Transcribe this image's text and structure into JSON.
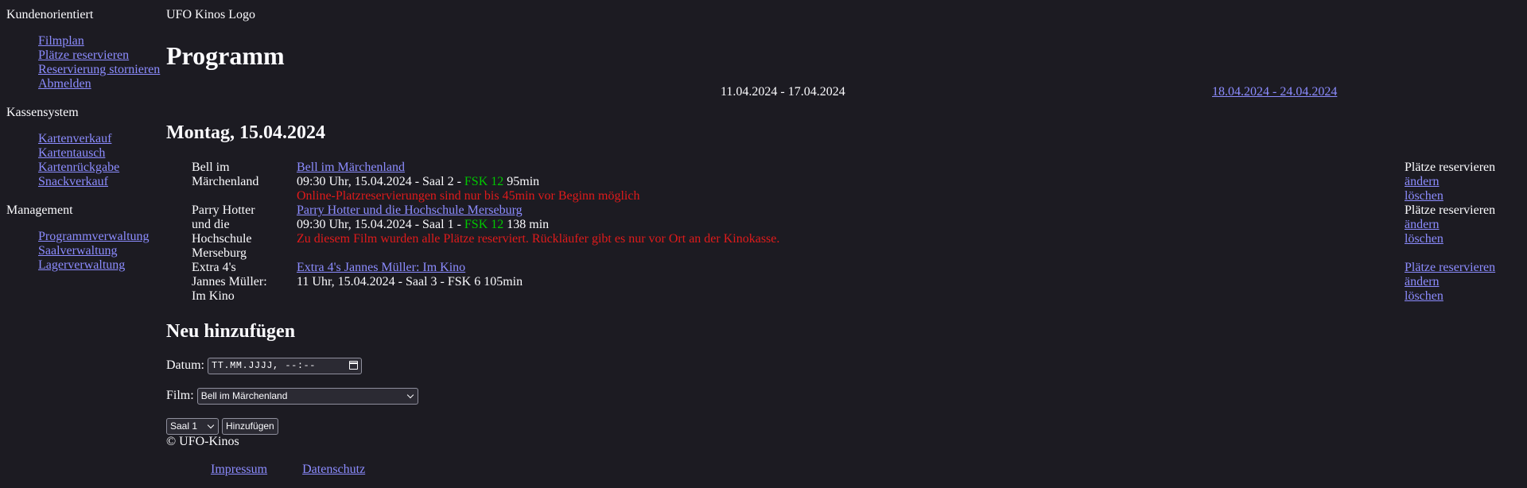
{
  "sidebar": {
    "sections": [
      {
        "heading": "Kundenorientiert",
        "items": [
          "Filmplan",
          "Plätze reservieren",
          "Reservierung stornieren",
          "Abmelden"
        ]
      },
      {
        "heading": "Kassensystem",
        "items": [
          "Kartenverkauf",
          "Kartentausch",
          "Kartenrückgabe",
          "Snackverkauf"
        ]
      },
      {
        "heading": "Management",
        "items": [
          "Programmverwaltung",
          "Saalverwaltung",
          "Lagerverwaltung"
        ]
      }
    ]
  },
  "header": {
    "logo_text": "UFO Kinos Logo",
    "title": "Programm"
  },
  "week": {
    "current": "11.04.2024 - 17.04.2024",
    "next": "18.04.2024 - 24.04.2024"
  },
  "day_title": "Montag, 15.04.2024",
  "shows": [
    {
      "short_title": "Bell im Märchenland",
      "title": "Bell im Märchenland",
      "time_prefix": "09:30 Uhr, 15.04.2024 - Saal 2 - ",
      "fsk": "FSK 12",
      "duration": " 95min",
      "warning": "Online-Platzreservierungen sind nur bis 45min vor Beginn möglich",
      "reserve_label": "Plätze reservieren",
      "edit_label": "ändern",
      "delete_label": "löschen"
    },
    {
      "short_title": "Parry Hotter und die Hochschule Merseburg",
      "title": "Parry Hotter und die Hochschule Merseburg",
      "time_prefix": "09:30 Uhr, 15.04.2024 - Saal 1 - ",
      "fsk": "FSK 12",
      "duration": " 138 min",
      "warning": "Zu diesem Film wurden alle Plätze reserviert. Rückläufer gibt es nur vor Ort an der Kinokasse.",
      "reserve_label": "Plätze reservieren",
      "edit_label": "ändern",
      "delete_label": "löschen"
    },
    {
      "short_title": "Extra 4's Jannes Müller: Im Kino",
      "title": "Extra 4's Jannes Müller: Im Kino",
      "time_prefix": "11 Uhr, 15.04.2024 - Saal 3 - FSK 6 105min",
      "reserve_label": "Plätze reservieren",
      "edit_label": "ändern",
      "delete_label": "löschen"
    }
  ],
  "add_form": {
    "title": "Neu hinzufügen",
    "date_label": "Datum:",
    "date_placeholder": "TT.MM.JJJJ, --:--",
    "film_label": "Film:",
    "film_value": "Bell im Märchenland",
    "saal_value": "Saal 1",
    "submit_label": "Hinzufügen"
  },
  "footer": {
    "copyright": "© UFO-Kinos",
    "links": [
      "Impressum",
      "Datenschutz"
    ]
  }
}
